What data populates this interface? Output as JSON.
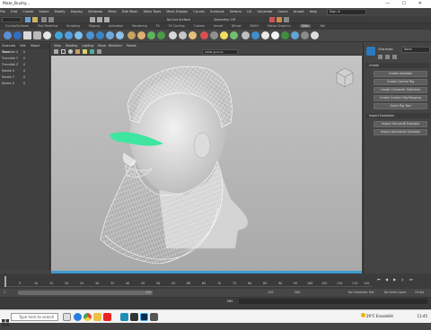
{
  "window": {
    "title": "Male_Bushy...",
    "controls": "— ☐ ✕"
  },
  "menubar": {
    "items": [
      "File",
      "Edit",
      "Create",
      "Select",
      "Modify",
      "Display",
      "Windows",
      "Mesh",
      "Edit Mesh",
      "Mesh Tools",
      "Mesh Display",
      "Curves",
      "Surfaces",
      "Deform",
      "UV",
      "Generate",
      "Cache",
      "Arnold",
      "Help"
    ],
    "sign_in": "Sign In"
  },
  "shelf_tabs": [
    "Curves/Surfaces",
    "Poly Modeling",
    "Sculpting",
    "Rigging",
    "Animation",
    "Rendering",
    "FX",
    "FX Caching",
    "Custom",
    "Arnold",
    "Bifrost",
    "MASH",
    "Motion Graphics",
    "XGen",
    "Yeti"
  ],
  "active_shelf_tab": "XGen",
  "surface_field": "No Live Surface",
  "symmetry": "Symmetry: Off",
  "left_panel": {
    "tabs": [
      "Channels",
      "Edit",
      "Object",
      "Show"
    ],
    "channels": [
      {
        "name": "Translate X",
        "value": "0"
      },
      {
        "name": "Translate Y",
        "value": "0"
      },
      {
        "name": "Translate Z",
        "value": "0"
      },
      {
        "name": "Rotate X",
        "value": "0"
      },
      {
        "name": "Rotate Y",
        "value": "0"
      },
      {
        "name": "Rotate Z",
        "value": "0"
      }
    ]
  },
  "viewport": {
    "menus": [
      "View",
      "Shading",
      "Lighting",
      "Show",
      "Renderer",
      "Panels"
    ],
    "color_space": "sRGB gamma"
  },
  "right_panel": {
    "character_label": "Character:",
    "character_value": "None",
    "section_create": "Create",
    "buttons": [
      "Create Skeleton",
      "Create Control Rig",
      "Create Character Definition",
      "Create Custom Rig Mapping",
      "Quick Rig Tool"
    ],
    "section_import": "Import Examples",
    "import_buttons": [
      "Import HumanIK Example",
      "Import Animation Example"
    ]
  },
  "timeline": {
    "ticks": [
      "5",
      "10",
      "15",
      "20",
      "25",
      "30",
      "35",
      "40",
      "45",
      "50",
      "55",
      "60",
      "65",
      "70",
      "75",
      "80",
      "85",
      "90",
      "95",
      "100",
      "105",
      "110",
      "115",
      "120"
    ],
    "start": "1",
    "end": "120",
    "range_end": "200",
    "no_char_set": "No Character Set",
    "no_anim_layer": "No Anim Layer",
    "fps": "24 fps"
  },
  "command_line": {
    "label": "MEL"
  },
  "taskbar": {
    "search_placeholder": "Type here to search",
    "weather": "29°C Ensoleillé",
    "time": "11:45"
  }
}
